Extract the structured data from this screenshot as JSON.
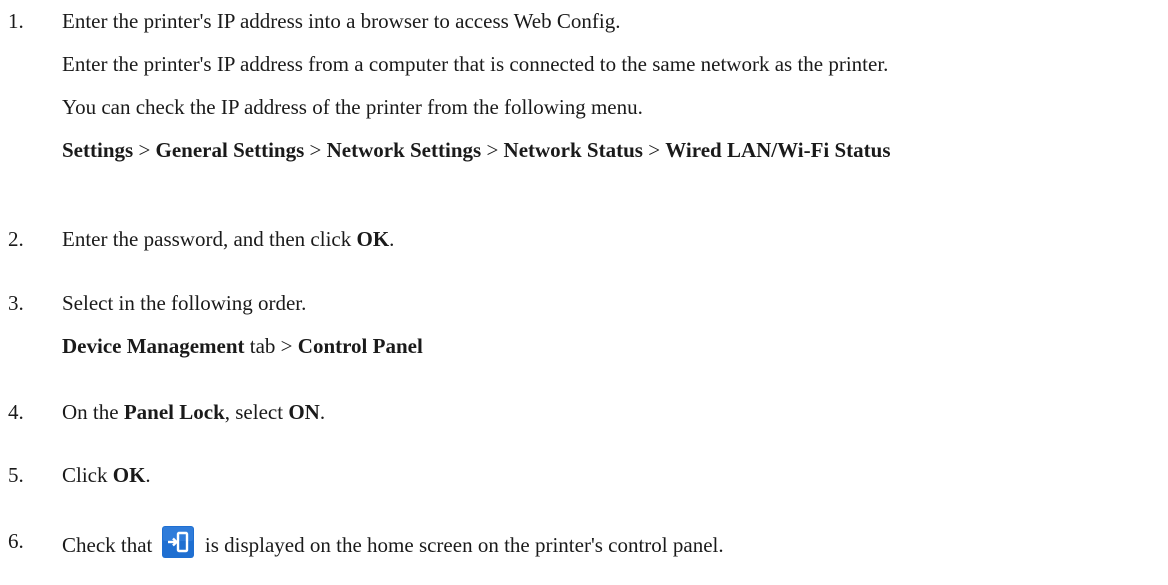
{
  "steps": [
    {
      "number": "1.",
      "lines": [
        [
          "Enter the printer's IP address into a browser to access Web Config."
        ],
        [
          "Enter the printer's IP address from a computer that is connected to the same network as the printer."
        ],
        [
          "You can check the IP address of the printer from the following menu."
        ],
        [
          "Settings",
          "General Settings",
          "Network Settings",
          "Network Status",
          "Wired LAN/Wi-Fi Status"
        ]
      ]
    },
    {
      "number": "2.",
      "text_before": "Enter the password, and then click ",
      "bold": "OK",
      "text_after": "."
    },
    {
      "number": "3.",
      "line1": "Select in the following order.",
      "bold1": "Device Management",
      "middle": " tab > ",
      "bold2": "Control Panel"
    },
    {
      "number": "4.",
      "text_before": "On the ",
      "bold1": "Panel Lock",
      "middle": ", select ",
      "bold2": "ON",
      "text_after": "."
    },
    {
      "number": "5.",
      "text_before": "Click ",
      "bold": "OK",
      "text_after": "."
    },
    {
      "number": "6.",
      "text_before": "Check that ",
      "icon": "panel-lock-icon",
      "text_after": " is displayed on the home screen on the printer's control panel."
    }
  ],
  "separator": " > ",
  "colors": {
    "text": "#1a1a1a",
    "icon_bg": "#1f6fd1",
    "icon_fg": "#ffffff"
  }
}
